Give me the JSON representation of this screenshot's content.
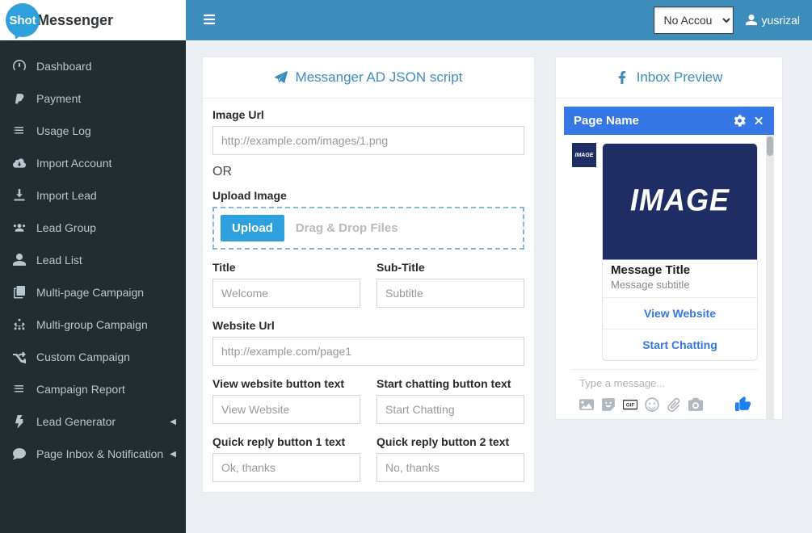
{
  "brand": {
    "shot": "Shot",
    "messenger": "Messenger"
  },
  "topbar": {
    "account_option": "No Accou",
    "username": "yusrizal"
  },
  "sidebar": {
    "items": [
      {
        "icon": "dashboard-icon",
        "label": "Dashboard"
      },
      {
        "icon": "paypal-icon",
        "label": "Payment"
      },
      {
        "icon": "list-icon",
        "label": "Usage Log"
      },
      {
        "icon": "cloud-down-icon",
        "label": "Import Account"
      },
      {
        "icon": "download-icon",
        "label": "Import Lead"
      },
      {
        "icon": "users-icon",
        "label": "Lead Group"
      },
      {
        "icon": "user-icon",
        "label": "Lead List"
      },
      {
        "icon": "copy-icon",
        "label": "Multi-page Campaign"
      },
      {
        "icon": "sitemap-icon",
        "label": "Multi-group Campaign"
      },
      {
        "icon": "random-icon",
        "label": "Custom Campaign"
      },
      {
        "icon": "list-icon",
        "label": "Campaign Report"
      },
      {
        "icon": "bolt-icon",
        "label": "Lead Generator",
        "chev": true
      },
      {
        "icon": "comment-icon",
        "label": "Page Inbox & Notification",
        "chev": true
      }
    ]
  },
  "form": {
    "panel_title": "Messanger AD JSON script",
    "image_url_label": "Image Url",
    "image_url_placeholder": "http://example.com/images/1.png",
    "or_text": "OR",
    "upload_label": "Upload Image",
    "upload_btn": "Upload",
    "dnd_text": "Drag & Drop Files",
    "title_label": "Title",
    "title_placeholder": "Welcome",
    "subtitle_label": "Sub-Title",
    "subtitle_placeholder": "Subtitle",
    "website_label": "Website Url",
    "website_placeholder": "http://example.com/page1",
    "view_btn_label": "View website button text",
    "view_btn_placeholder": "View Website",
    "chat_btn_label": "Start chatting button text",
    "chat_btn_placeholder": "Start Chatting",
    "qr1_label": "Quick reply button 1 text",
    "qr1_placeholder": "Ok, thanks",
    "qr2_label": "Quick reply button 2 text",
    "qr2_placeholder": "No, thanks"
  },
  "preview": {
    "panel_title": "Inbox Preview",
    "page_name": "Page Name",
    "avatar_text": "IMAGE",
    "image_text": "IMAGE",
    "msg_title": "Message Title",
    "msg_sub": "Message subtitle",
    "btn1": "View Website",
    "btn2": "Start Chatting",
    "compose_placeholder": "Type a message..."
  }
}
